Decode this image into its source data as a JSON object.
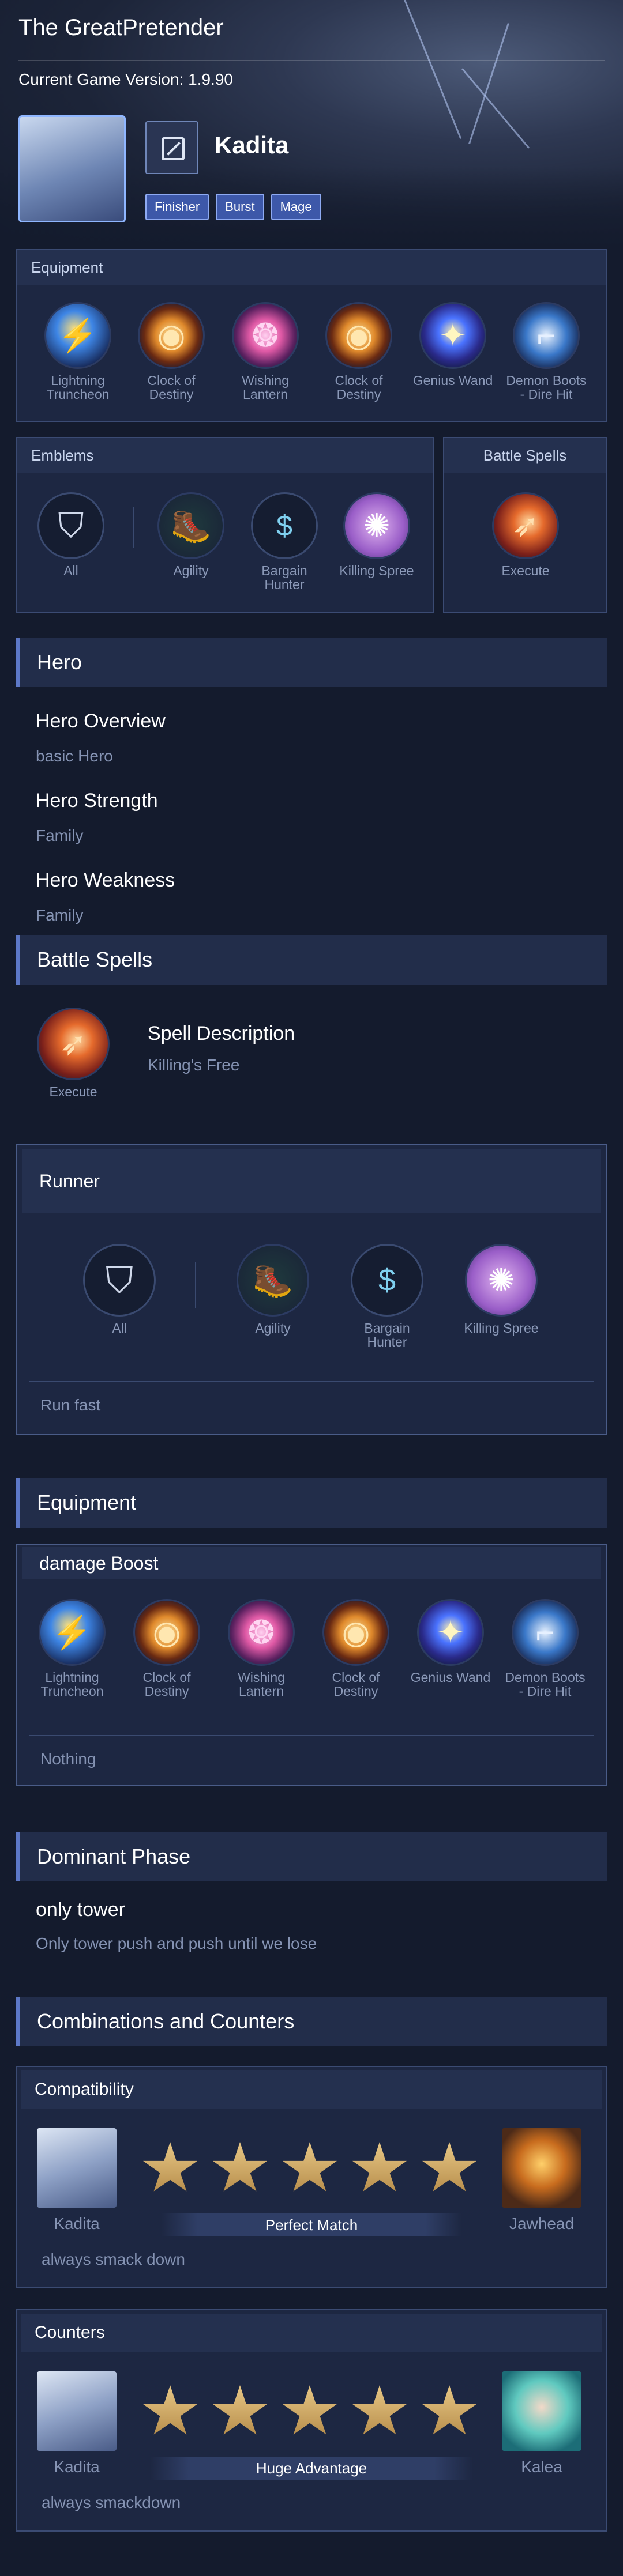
{
  "app": {
    "title": "The GreatPretender",
    "version": "Current Game Version: 1.9.90"
  },
  "hero": {
    "name": "Kadita",
    "tags": [
      "Finisher",
      "Burst",
      "Mage"
    ]
  },
  "colors": {
    "accent": "#5d78c7",
    "panel": "#1d2742",
    "background": "#141b2d",
    "tag": "#3d58a9"
  },
  "equipment_top": {
    "title": "Equipment",
    "items": [
      {
        "label": "Lightning Truncheon",
        "icon": "lightning-truncheon-icon"
      },
      {
        "label": "Clock of Destiny",
        "icon": "clock-of-destiny-icon"
      },
      {
        "label": "Wishing Lantern",
        "icon": "wishing-lantern-icon"
      },
      {
        "label": "Clock of Destiny",
        "icon": "clock-of-destiny-icon"
      },
      {
        "label": "Genius Wand",
        "icon": "genius-wand-icon"
      },
      {
        "label": "Demon Boots - Dire Hit",
        "icon": "demon-boots-icon"
      }
    ]
  },
  "emblems_top": {
    "title": "Emblems",
    "items": [
      {
        "label": "All",
        "icon": "shield-emblem-icon"
      },
      {
        "label": "Agility",
        "icon": "agility-boot-icon"
      },
      {
        "label": "Bargain Hunter",
        "icon": "bargain-hunter-icon"
      },
      {
        "label": "Killing Spree",
        "icon": "killing-spree-icon"
      }
    ]
  },
  "battle_spells_top": {
    "title": "Battle Spells",
    "spell": {
      "label": "Execute",
      "icon": "execute-icon"
    }
  },
  "hero_section": {
    "title": "Hero",
    "overview_title": "Hero Overview",
    "overview_text": "basic Hero",
    "strength_title": "Hero Strength",
    "strength_text": "Family",
    "weakness_title": "Hero Weakness",
    "weakness_text": "Family"
  },
  "battle_spells_section": {
    "title": "Battle Spells",
    "spell_label": "Execute",
    "desc_title": "Spell Description",
    "desc_text": "Killing's Free"
  },
  "runner": {
    "title": "Runner",
    "items": [
      {
        "label": "All",
        "icon": "shield-emblem-icon"
      },
      {
        "label": "Agility",
        "icon": "agility-boot-icon"
      },
      {
        "label": "Bargain Hunter",
        "icon": "bargain-hunter-icon"
      },
      {
        "label": "Killing Spree",
        "icon": "killing-spree-icon"
      }
    ],
    "note": "Run fast"
  },
  "equipment_section": {
    "title": "Equipment",
    "build_title": "damage Boost",
    "items": [
      {
        "label": "Lightning Truncheon"
      },
      {
        "label": "Clock of Destiny"
      },
      {
        "label": "Wishing Lantern"
      },
      {
        "label": "Clock of Destiny"
      },
      {
        "label": "Genius Wand"
      },
      {
        "label": "Demon Boots - Dire Hit"
      }
    ],
    "note": "Nothing"
  },
  "dominant": {
    "title": "Dominant Phase",
    "phase": "only tower",
    "desc": "Only tower push and push until we lose"
  },
  "combos": {
    "title": "Combinations and Counters",
    "compatibility": {
      "title": "Compatibility",
      "left": "Kadita",
      "right": "Jawhead",
      "rating": 5,
      "max": 5,
      "verdict": "Perfect Match",
      "note": "always smack down"
    },
    "counters": {
      "title": "Counters",
      "left": "Kadita",
      "right": "Kalea",
      "rating": 5,
      "max": 5,
      "verdict": "Huge Advantage",
      "note": "always smackdown"
    }
  }
}
